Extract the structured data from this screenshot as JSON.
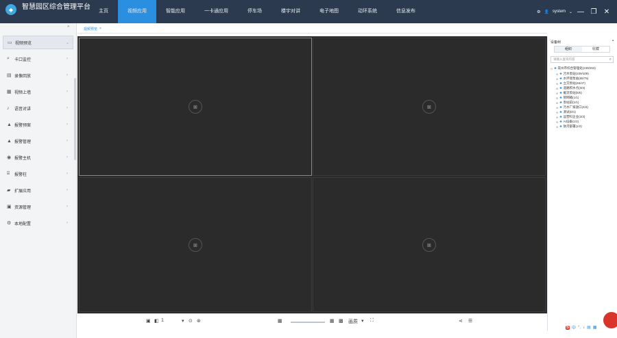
{
  "header": {
    "app_title": "智慧园区综合管理平台",
    "nav": [
      "主页",
      "视频应用",
      "智能应用",
      "一卡通应用",
      "停车场",
      "楼宇对讲",
      "电子地图",
      "动环系统",
      "信息发布"
    ],
    "active_nav_index": 1,
    "user": "system",
    "accent_color": "#2a8fe0",
    "header_bg": "#2b3a4f"
  },
  "sidebar": {
    "collapse_icon": "double-chevron-left-icon",
    "items": [
      {
        "label": "视频预览",
        "icon": "camera-icon",
        "active": true
      },
      {
        "label": "卡口监控",
        "icon": "search-icon"
      },
      {
        "label": "录像回放",
        "icon": "playback-icon"
      },
      {
        "label": "视频上墙",
        "icon": "grid-icon"
      },
      {
        "label": "语音对讲",
        "icon": "microphone-icon"
      },
      {
        "label": "报警预案",
        "icon": "alarm-icon"
      },
      {
        "label": "报警管理",
        "icon": "alarm-manage-icon"
      },
      {
        "label": "报警主机",
        "icon": "host-icon"
      },
      {
        "label": "报警柱",
        "icon": "pillar-icon"
      },
      {
        "label": "扩展应用",
        "icon": "folder-icon"
      },
      {
        "label": "资源管理",
        "icon": "resource-icon"
      },
      {
        "label": "本地配置",
        "icon": "settings-icon"
      }
    ]
  },
  "tab": {
    "label": "视频预览",
    "close": "×"
  },
  "video": {
    "panes": 4,
    "placeholder_icon": "camera-icon"
  },
  "toolbar": {
    "stream_label": "1",
    "layout_label": "画质"
  },
  "right_panel": {
    "title": "设备树",
    "tabs": [
      "组织",
      "收藏"
    ],
    "search_placeholder": "请输入查询内容",
    "root": "常州市综合管理处(239/253)",
    "children": [
      "污水泵站(109/109)",
      "水环境泵站(65/75)",
      "立交泵站(46/47)",
      "道路积水点(3/3)",
      "截流泵站(5/5)",
      "管网箱(1/1)",
      "泵站前(1/1)",
      "污水厂排放口(4/4)",
      "测试(0/1)",
      "运营科企业(3/3)",
      "AI设备(1/2)",
      "防涝部署(1/2)"
    ]
  }
}
